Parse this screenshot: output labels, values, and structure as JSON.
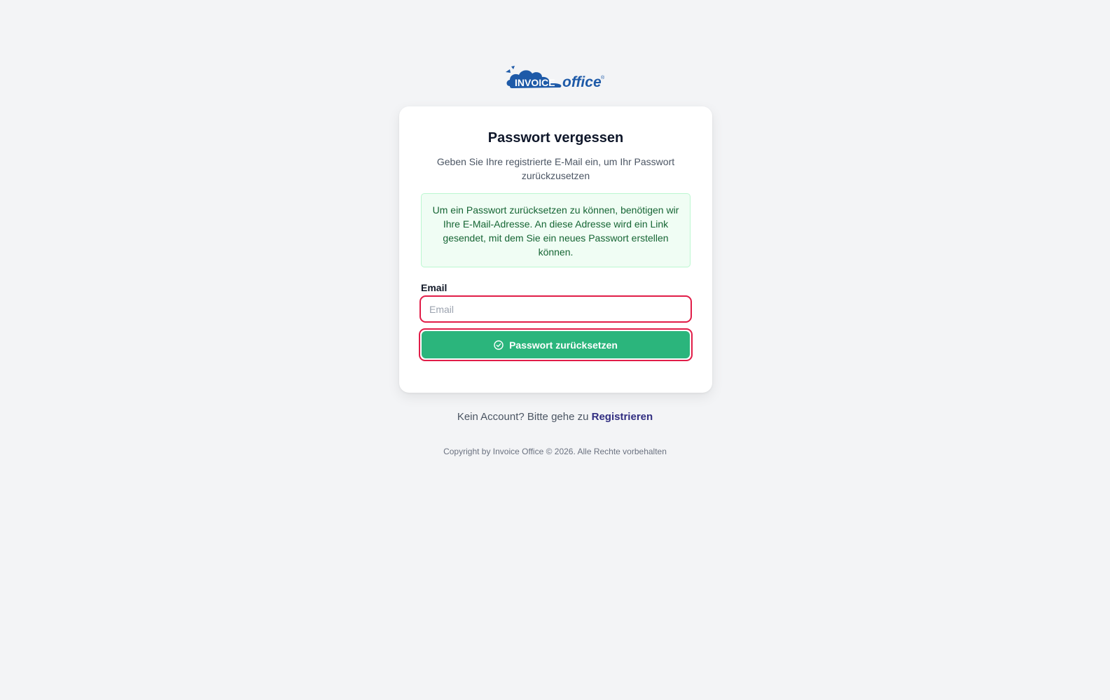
{
  "logo": {
    "word_invoice": "INVOICE",
    "word_office": "office",
    "registered_mark": "®",
    "brand_color": "#1e5aa8"
  },
  "card": {
    "title": "Passwort vergessen",
    "subtitle": "Geben Sie Ihre registrierte E-Mail ein, um Ihr Passwort zurückzusetzen",
    "info_message": "Um ein Passwort zurücksetzen zu können, benötigen wir Ihre E-Mail-Adresse. An diese Adresse wird ein Link gesendet, mit dem Sie ein neues Passwort erstellen können.",
    "email_label": "Email",
    "email_placeholder": "Email",
    "email_value": "",
    "submit_label": "Passwort zurücksetzen",
    "submit_icon": "check-circle-icon",
    "button_color": "#2bb57c",
    "highlight_color": "#e11d48"
  },
  "footer": {
    "register_prompt": "Kein Account? Bitte gehe zu",
    "register_link": "Registrieren",
    "copyright": "Copyright by Invoice Office © 2026. Alle Rechte vorbehalten"
  }
}
